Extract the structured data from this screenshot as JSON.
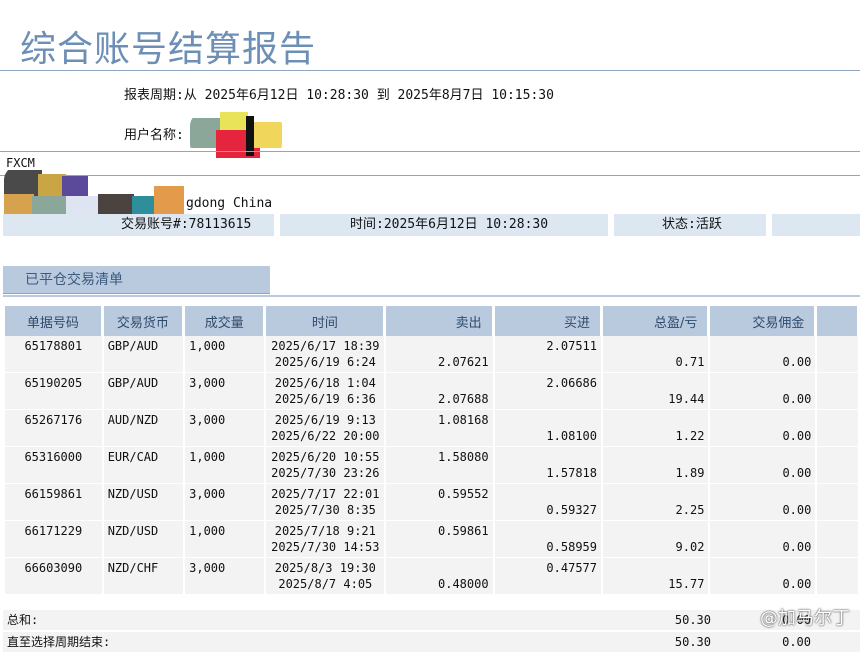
{
  "report_title": "综合账号结算报告",
  "period_label": "报表周期:从 2025年6月12日 10:28:30 到 2025年8月7日 10:15:30",
  "username_label": "用户名称:",
  "broker": "FXCM",
  "address_fragment": "gdong China",
  "account_number_label": "交易账号#:78113615",
  "time_label": "时间:2025年6月12日 10:28:30",
  "status_label": "状态:活跃",
  "section_title": "已平仓交易清单",
  "table": {
    "headers": [
      "单据号码",
      "交易货币",
      "成交量",
      "时间",
      "卖出",
      "买进",
      "总盈/亏",
      "交易佣金"
    ],
    "rows": [
      {
        "id": "65178801",
        "pair": "GBP/AUD",
        "volume": "1,000",
        "time_open": "2025/6/17 18:39",
        "time_close": "2025/6/19 6:24",
        "sell_top": "",
        "sell_bottom": "2.07621",
        "buy_top": "2.07511",
        "buy_bottom": "",
        "pl": "0.71",
        "commission": "0.00"
      },
      {
        "id": "65190205",
        "pair": "GBP/AUD",
        "volume": "3,000",
        "time_open": "2025/6/18 1:04",
        "time_close": "2025/6/19 6:36",
        "sell_top": "",
        "sell_bottom": "2.07688",
        "buy_top": "2.06686",
        "buy_bottom": "",
        "pl": "19.44",
        "commission": "0.00"
      },
      {
        "id": "65267176",
        "pair": "AUD/NZD",
        "volume": "3,000",
        "time_open": "2025/6/19 9:13",
        "time_close": "2025/6/22 20:00",
        "sell_top": "1.08168",
        "sell_bottom": "",
        "buy_top": "",
        "buy_bottom": "1.08100",
        "pl": "1.22",
        "commission": "0.00"
      },
      {
        "id": "65316000",
        "pair": "EUR/CAD",
        "volume": "1,000",
        "time_open": "2025/6/20 10:55",
        "time_close": "2025/7/30 23:26",
        "sell_top": "1.58080",
        "sell_bottom": "",
        "buy_top": "",
        "buy_bottom": "1.57818",
        "pl": "1.89",
        "commission": "0.00"
      },
      {
        "id": "66159861",
        "pair": "NZD/USD",
        "volume": "3,000",
        "time_open": "2025/7/17 22:01",
        "time_close": "2025/7/30 8:35",
        "sell_top": "0.59552",
        "sell_bottom": "",
        "buy_top": "",
        "buy_bottom": "0.59327",
        "pl": "2.25",
        "commission": "0.00"
      },
      {
        "id": "66171229",
        "pair": "NZD/USD",
        "volume": "1,000",
        "time_open": "2025/7/18 9:21",
        "time_close": "2025/7/30 14:53",
        "sell_top": "0.59861",
        "sell_bottom": "",
        "buy_top": "",
        "buy_bottom": "0.58959",
        "pl": "9.02",
        "commission": "0.00"
      },
      {
        "id": "66603090",
        "pair": "NZD/CHF",
        "volume": "3,000",
        "time_open": "2025/8/3 19:30",
        "time_close": "2025/8/7 4:05",
        "sell_top": "",
        "sell_bottom": "0.48000",
        "buy_top": "0.47577",
        "buy_bottom": "",
        "pl": "15.77",
        "commission": "0.00"
      }
    ]
  },
  "totals": {
    "sum_label": "总和:",
    "sum_pl": "50.30",
    "sum_commission": "0.00",
    "period_end_label": "直至选择周期结束:",
    "period_end_pl": "50.30",
    "period_end_commission": "0.00"
  },
  "watermark": "@加马尔丁"
}
